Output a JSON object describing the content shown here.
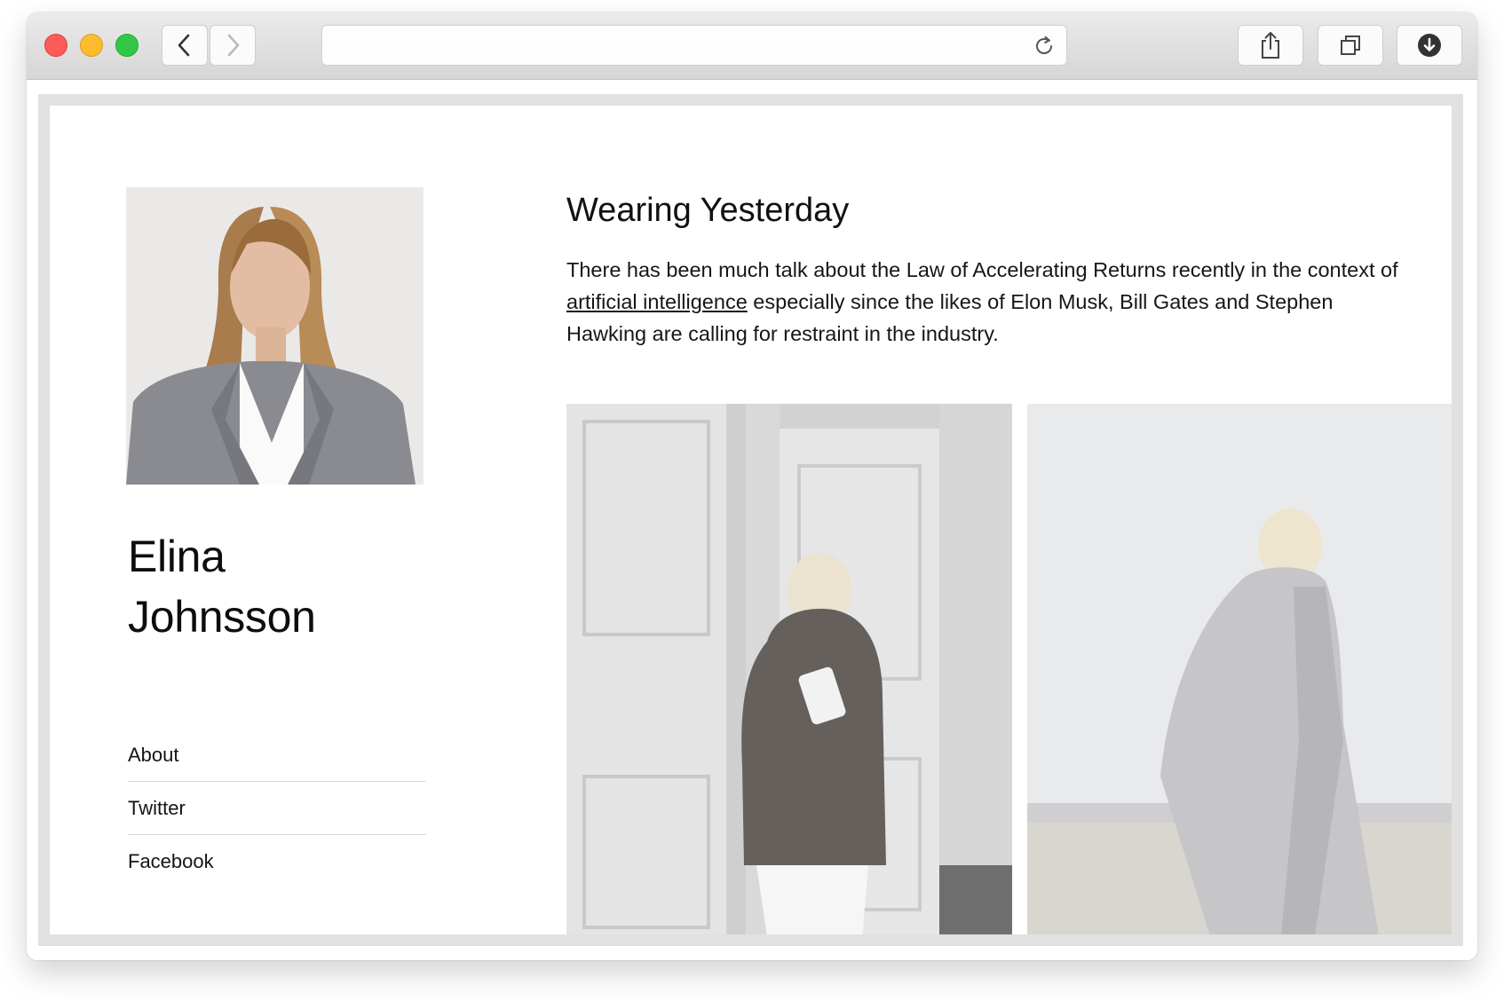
{
  "browser": {
    "address_value": "",
    "icons": {
      "back": "chevron-left-icon",
      "forward": "chevron-right-icon",
      "reload": "reload-icon",
      "share": "share-icon",
      "tabs": "tabs-icon",
      "download": "download-icon"
    }
  },
  "profile": {
    "first_name": "Elina",
    "last_name": "Johnsson"
  },
  "nav": {
    "items": [
      "About",
      "Twitter",
      "Facebook"
    ]
  },
  "post": {
    "title": "Wearing Yesterday",
    "body_before_link": "There has been much talk about the Law of Accelerating Returns recently in the context of ",
    "link_text": "artificial intelligence",
    "body_after_link": " especially since the likes of Elon Musk, Bill Gates and Stephen Hawking are calling for restraint in the industry."
  },
  "colors": {
    "close": "#fc5b57",
    "minimize": "#fdbc2e",
    "zoom": "#33c748",
    "frame_border": "#e1e1e1"
  }
}
